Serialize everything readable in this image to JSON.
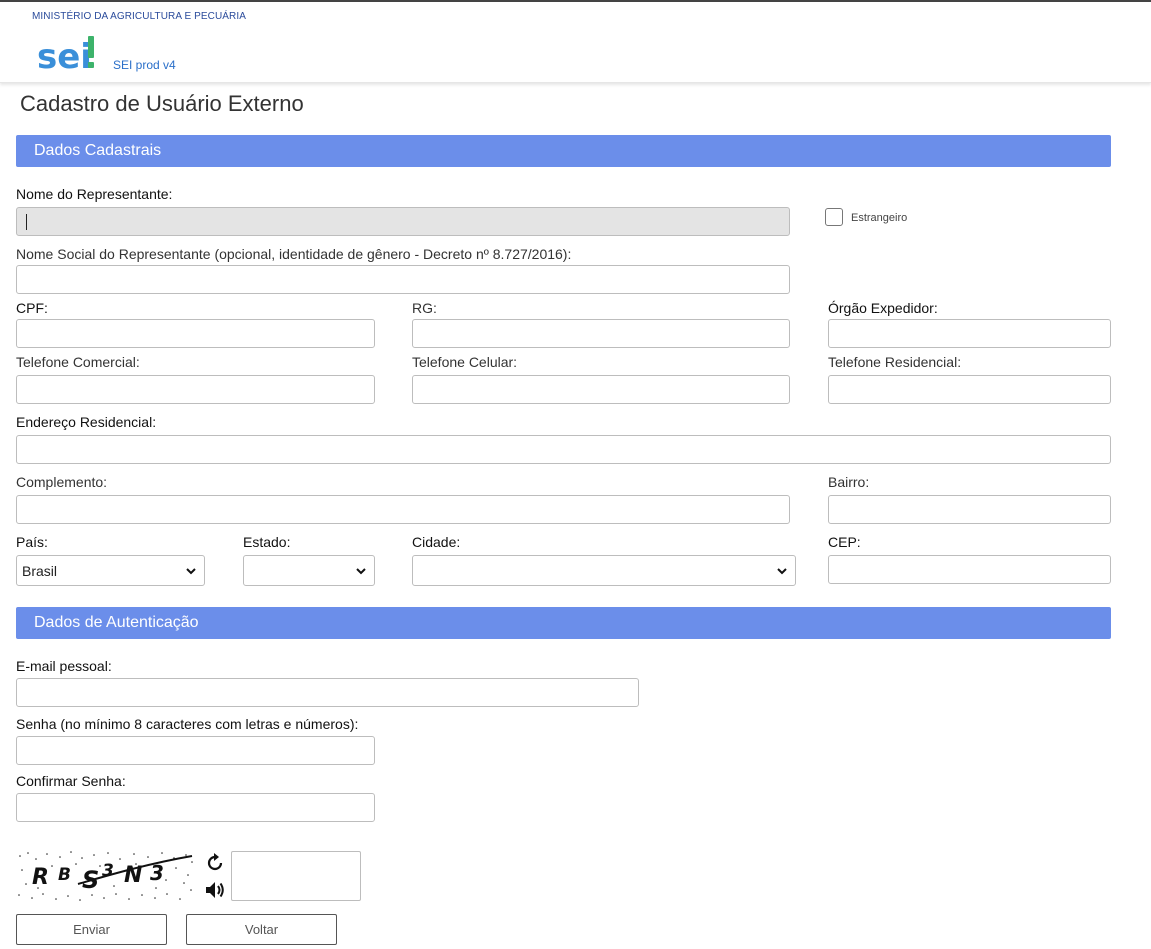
{
  "header": {
    "org_name": "MINISTÉRIO DA AGRICULTURA E PECUÁRIA",
    "logo_text": "sei!",
    "environment": "SEI prod v4"
  },
  "page_title": "Cadastro de Usuário Externo",
  "sections": {
    "dados_cadastrais": "Dados Cadastrais",
    "dados_autenticacao": "Dados de Autenticação"
  },
  "form": {
    "nome_representante": {
      "label": "Nome do Representante:",
      "value": ""
    },
    "estrangeiro": {
      "label": "Estrangeiro",
      "checked": false
    },
    "nome_social": {
      "label": "Nome Social do Representante (opcional, identidade de gênero - Decreto nº 8.727/2016):",
      "value": ""
    },
    "cpf": {
      "label": "CPF:",
      "value": ""
    },
    "rg": {
      "label": "RG:",
      "value": ""
    },
    "orgao_expedidor": {
      "label": "Órgão Expedidor:",
      "value": ""
    },
    "telefone_comercial": {
      "label": "Telefone Comercial:",
      "value": ""
    },
    "telefone_celular": {
      "label": "Telefone Celular:",
      "value": ""
    },
    "telefone_residencial": {
      "label": "Telefone Residencial:",
      "value": ""
    },
    "endereco_residencial": {
      "label": "Endereço Residencial:",
      "value": ""
    },
    "complemento": {
      "label": "Complemento:",
      "value": ""
    },
    "bairro": {
      "label": "Bairro:",
      "value": ""
    },
    "pais": {
      "label": "País:",
      "value": "Brasil"
    },
    "estado": {
      "label": "Estado:",
      "value": ""
    },
    "cidade": {
      "label": "Cidade:",
      "value": ""
    },
    "cep": {
      "label": "CEP:",
      "value": ""
    },
    "email": {
      "label": "E-mail pessoal:",
      "value": ""
    },
    "senha": {
      "label": "Senha (no mínimo 8 caracteres com letras e números):",
      "value": ""
    },
    "confirmar_senha": {
      "label": "Confirmar Senha:",
      "value": ""
    }
  },
  "captcha": {
    "image_text": "RBS3N3",
    "refresh_icon": "refresh-icon",
    "audio_icon": "speaker-icon",
    "value": ""
  },
  "buttons": {
    "enviar": "Enviar",
    "voltar": "Voltar"
  },
  "colors": {
    "section_bar": "#6b8eea",
    "org_text": "#2a4b9b",
    "logo_blue": "#3a8fd9",
    "logo_green": "#3db36b"
  }
}
